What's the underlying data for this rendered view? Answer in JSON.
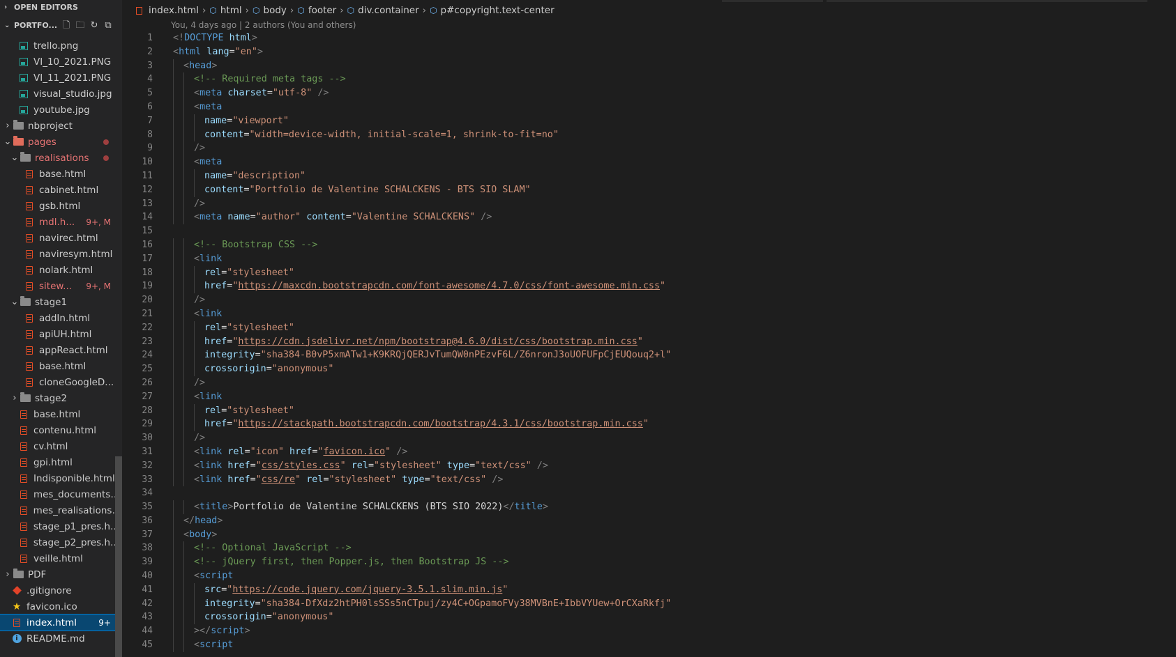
{
  "sidebar": {
    "open_editors_label": "OPEN EDITORS",
    "workspace_label": "PORTFO...",
    "items": [
      {
        "label": "trello.png",
        "icon": "image-file-icon",
        "indent": 2,
        "type": "img"
      },
      {
        "label": "VI_10_2021.PNG",
        "icon": "image-file-icon",
        "indent": 2,
        "type": "img"
      },
      {
        "label": "VI_11_2021.PNG",
        "icon": "image-file-icon",
        "indent": 2,
        "type": "img"
      },
      {
        "label": "visual_studio.jpg",
        "icon": "image-file-icon",
        "indent": 2,
        "type": "img"
      },
      {
        "label": "youtube.jpg",
        "icon": "image-file-icon",
        "indent": 2,
        "type": "img"
      },
      {
        "label": "nbproject",
        "icon": "folder-icon",
        "indent": 1,
        "type": "folder",
        "chevron": "›"
      },
      {
        "label": "pages",
        "icon": "folder-open-icon",
        "indent": 1,
        "type": "folder-red",
        "chevron": "⌄",
        "dot": true,
        "modified": true
      },
      {
        "label": "realisations",
        "icon": "folder-open-icon",
        "indent": 2,
        "type": "folder",
        "chevron": "⌄",
        "dot": true,
        "modified": true
      },
      {
        "label": "base.html",
        "icon": "html-file-icon",
        "indent": 3,
        "type": "html"
      },
      {
        "label": "cabinet.html",
        "icon": "html-file-icon",
        "indent": 3,
        "type": "html"
      },
      {
        "label": "gsb.html",
        "icon": "html-file-icon",
        "indent": 3,
        "type": "html"
      },
      {
        "label": "mdl.h...",
        "icon": "html-file-icon",
        "indent": 3,
        "type": "html",
        "badge": "9+, M",
        "modified": true
      },
      {
        "label": "navirec.html",
        "icon": "html-file-icon",
        "indent": 3,
        "type": "html"
      },
      {
        "label": "naviresym.html",
        "icon": "html-file-icon",
        "indent": 3,
        "type": "html"
      },
      {
        "label": "nolark.html",
        "icon": "html-file-icon",
        "indent": 3,
        "type": "html"
      },
      {
        "label": "sitew...",
        "icon": "html-file-icon",
        "indent": 3,
        "type": "html",
        "badge": "9+, M",
        "modified": true
      },
      {
        "label": "stage1",
        "icon": "folder-open-icon",
        "indent": 2,
        "type": "folder",
        "chevron": "⌄"
      },
      {
        "label": "addIn.html",
        "icon": "html-file-icon",
        "indent": 3,
        "type": "html"
      },
      {
        "label": "apiUH.html",
        "icon": "html-file-icon",
        "indent": 3,
        "type": "html"
      },
      {
        "label": "appReact.html",
        "icon": "html-file-icon",
        "indent": 3,
        "type": "html"
      },
      {
        "label": "base.html",
        "icon": "html-file-icon",
        "indent": 3,
        "type": "html"
      },
      {
        "label": "cloneGoogleD...",
        "icon": "html-file-icon",
        "indent": 3,
        "type": "html"
      },
      {
        "label": "stage2",
        "icon": "folder-icon",
        "indent": 2,
        "type": "folder",
        "chevron": "›"
      },
      {
        "label": "base.html",
        "icon": "html-file-icon",
        "indent": 2,
        "type": "html"
      },
      {
        "label": "contenu.html",
        "icon": "html-file-icon",
        "indent": 2,
        "type": "html"
      },
      {
        "label": "cv.html",
        "icon": "html-file-icon",
        "indent": 2,
        "type": "html"
      },
      {
        "label": "gpi.html",
        "icon": "html-file-icon",
        "indent": 2,
        "type": "html"
      },
      {
        "label": "Indisponible.html",
        "icon": "html-file-icon",
        "indent": 2,
        "type": "html"
      },
      {
        "label": "mes_documents....",
        "icon": "html-file-icon",
        "indent": 2,
        "type": "html"
      },
      {
        "label": "mes_realisations....",
        "icon": "html-file-icon",
        "indent": 2,
        "type": "html"
      },
      {
        "label": "stage_p1_pres.ht...",
        "icon": "html-file-icon",
        "indent": 2,
        "type": "html"
      },
      {
        "label": "stage_p2_pres.ht...",
        "icon": "html-file-icon",
        "indent": 2,
        "type": "html"
      },
      {
        "label": "veille.html",
        "icon": "html-file-icon",
        "indent": 2,
        "type": "html"
      },
      {
        "label": "PDF",
        "icon": "folder-icon",
        "indent": 1,
        "type": "folder",
        "chevron": "›"
      },
      {
        "label": ".gitignore",
        "icon": "git-icon",
        "indent": 1,
        "type": "git"
      },
      {
        "label": "favicon.ico",
        "icon": "star-icon",
        "indent": 1,
        "type": "star"
      },
      {
        "label": "index.html",
        "icon": "html-file-icon",
        "indent": 1,
        "type": "html",
        "badge": "9+",
        "selected": true
      },
      {
        "label": "README.md",
        "icon": "info-icon",
        "indent": 1,
        "type": "info"
      }
    ]
  },
  "breadcrumb": [
    {
      "label": "index.html",
      "icon": "html-file-icon"
    },
    {
      "label": "html",
      "icon": "element-icon"
    },
    {
      "label": "body",
      "icon": "element-icon"
    },
    {
      "label": "footer",
      "icon": "element-icon"
    },
    {
      "label": "div.container",
      "icon": "element-icon"
    },
    {
      "label": "p#copyright.text-center",
      "icon": "element-icon"
    }
  ],
  "blame": "You, 4 days ago | 2 authors (You and others)",
  "code_lines": [
    {
      "n": "1",
      "indent": 0,
      "tokens": [
        [
          "t",
          "<!"
        ],
        [
          "tag",
          "DOCTYPE"
        ],
        [
          "att",
          " html"
        ],
        [
          "t",
          ">"
        ]
      ]
    },
    {
      "n": "2",
      "indent": 0,
      "tokens": [
        [
          "t",
          "<"
        ],
        [
          "tag",
          "html"
        ],
        [
          "att",
          " lang"
        ],
        [
          "txt",
          "="
        ],
        [
          "str",
          "\"en\""
        ],
        [
          "t",
          ">"
        ]
      ]
    },
    {
      "n": "3",
      "indent": 1,
      "tokens": [
        [
          "t",
          "<"
        ],
        [
          "tag",
          "head"
        ],
        [
          "t",
          ">"
        ]
      ]
    },
    {
      "n": "4",
      "indent": 2,
      "tokens": [
        [
          "cm",
          "<!-- Required meta tags -->"
        ]
      ]
    },
    {
      "n": "5",
      "indent": 2,
      "tokens": [
        [
          "t",
          "<"
        ],
        [
          "tag",
          "meta"
        ],
        [
          "att",
          " charset"
        ],
        [
          "txt",
          "="
        ],
        [
          "str",
          "\"utf-8\""
        ],
        [
          "t",
          " />"
        ]
      ]
    },
    {
      "n": "6",
      "indent": 2,
      "tokens": [
        [
          "t",
          "<"
        ],
        [
          "tag",
          "meta"
        ]
      ]
    },
    {
      "n": "7",
      "indent": 3,
      "tokens": [
        [
          "att",
          "name"
        ],
        [
          "txt",
          "="
        ],
        [
          "str",
          "\"viewport\""
        ]
      ]
    },
    {
      "n": "8",
      "indent": 3,
      "tokens": [
        [
          "att",
          "content"
        ],
        [
          "txt",
          "="
        ],
        [
          "str",
          "\"width=device-width, initial-scale=1, shrink-to-fit=no\""
        ]
      ]
    },
    {
      "n": "9",
      "indent": 2,
      "tokens": [
        [
          "t",
          "/>"
        ]
      ]
    },
    {
      "n": "10",
      "indent": 2,
      "tokens": [
        [
          "t",
          "<"
        ],
        [
          "tag",
          "meta"
        ]
      ]
    },
    {
      "n": "11",
      "indent": 3,
      "tokens": [
        [
          "att",
          "name"
        ],
        [
          "txt",
          "="
        ],
        [
          "str",
          "\"description\""
        ]
      ]
    },
    {
      "n": "12",
      "indent": 3,
      "tokens": [
        [
          "att",
          "content"
        ],
        [
          "txt",
          "="
        ],
        [
          "str",
          "\"Portfolio de Valentine SCHALCKENS - BTS SIO SLAM\""
        ]
      ]
    },
    {
      "n": "13",
      "indent": 2,
      "tokens": [
        [
          "t",
          "/>"
        ]
      ]
    },
    {
      "n": "14",
      "indent": 2,
      "tokens": [
        [
          "t",
          "<"
        ],
        [
          "tag",
          "meta"
        ],
        [
          "att",
          " name"
        ],
        [
          "txt",
          "="
        ],
        [
          "str",
          "\"author\""
        ],
        [
          "att",
          " content"
        ],
        [
          "txt",
          "="
        ],
        [
          "str",
          "\"Valentine SCHALCKENS\""
        ],
        [
          "t",
          " />"
        ]
      ]
    },
    {
      "n": "15",
      "indent": 0,
      "tokens": []
    },
    {
      "n": "16",
      "indent": 2,
      "tokens": [
        [
          "cm",
          "<!-- Bootstrap CSS -->"
        ]
      ]
    },
    {
      "n": "17",
      "indent": 2,
      "tokens": [
        [
          "t",
          "<"
        ],
        [
          "tag",
          "link"
        ]
      ]
    },
    {
      "n": "18",
      "indent": 3,
      "tokens": [
        [
          "att",
          "rel"
        ],
        [
          "txt",
          "="
        ],
        [
          "str",
          "\"stylesheet\""
        ]
      ]
    },
    {
      "n": "19",
      "indent": 3,
      "tokens": [
        [
          "att",
          "href"
        ],
        [
          "txt",
          "="
        ],
        [
          "str",
          "\""
        ],
        [
          "url",
          "https://maxcdn.bootstrapcdn.com/font-awesome/4.7.0/css/font-awesome.min.css"
        ],
        [
          "str",
          "\""
        ]
      ]
    },
    {
      "n": "20",
      "indent": 2,
      "tokens": [
        [
          "t",
          "/>"
        ]
      ]
    },
    {
      "n": "21",
      "indent": 2,
      "tokens": [
        [
          "t",
          "<"
        ],
        [
          "tag",
          "link"
        ]
      ]
    },
    {
      "n": "22",
      "indent": 3,
      "tokens": [
        [
          "att",
          "rel"
        ],
        [
          "txt",
          "="
        ],
        [
          "str",
          "\"stylesheet\""
        ]
      ]
    },
    {
      "n": "23",
      "indent": 3,
      "tokens": [
        [
          "att",
          "href"
        ],
        [
          "txt",
          "="
        ],
        [
          "str",
          "\""
        ],
        [
          "url",
          "https://cdn.jsdelivr.net/npm/bootstrap@4.6.0/dist/css/bootstrap.min.css"
        ],
        [
          "str",
          "\""
        ]
      ]
    },
    {
      "n": "24",
      "indent": 3,
      "tokens": [
        [
          "att",
          "integrity"
        ],
        [
          "txt",
          "="
        ],
        [
          "str",
          "\"sha384-B0vP5xmATw1+K9KRQjQERJvTumQW0nPEzvF6L/Z6nronJ3oUOFUFpCjEUQouq2+l\""
        ]
      ]
    },
    {
      "n": "25",
      "indent": 3,
      "tokens": [
        [
          "att",
          "crossorigin"
        ],
        [
          "txt",
          "="
        ],
        [
          "str",
          "\"anonymous\""
        ]
      ]
    },
    {
      "n": "26",
      "indent": 2,
      "tokens": [
        [
          "t",
          "/>"
        ]
      ]
    },
    {
      "n": "27",
      "indent": 2,
      "tokens": [
        [
          "t",
          "<"
        ],
        [
          "tag",
          "link"
        ]
      ]
    },
    {
      "n": "28",
      "indent": 3,
      "tokens": [
        [
          "att",
          "rel"
        ],
        [
          "txt",
          "="
        ],
        [
          "str",
          "\"stylesheet\""
        ]
      ]
    },
    {
      "n": "29",
      "indent": 3,
      "tokens": [
        [
          "att",
          "href"
        ],
        [
          "txt",
          "="
        ],
        [
          "str",
          "\""
        ],
        [
          "url",
          "https://stackpath.bootstrapcdn.com/bootstrap/4.3.1/css/bootstrap.min.css"
        ],
        [
          "str",
          "\""
        ]
      ]
    },
    {
      "n": "30",
      "indent": 2,
      "tokens": [
        [
          "t",
          "/>"
        ]
      ]
    },
    {
      "n": "31",
      "indent": 2,
      "tokens": [
        [
          "t",
          "<"
        ],
        [
          "tag",
          "link"
        ],
        [
          "att",
          " rel"
        ],
        [
          "txt",
          "="
        ],
        [
          "str",
          "\"icon\""
        ],
        [
          "att",
          " href"
        ],
        [
          "txt",
          "="
        ],
        [
          "str",
          "\""
        ],
        [
          "url",
          "favicon.ico"
        ],
        [
          "str",
          "\""
        ],
        [
          "t",
          " />"
        ]
      ]
    },
    {
      "n": "32",
      "indent": 2,
      "tokens": [
        [
          "t",
          "<"
        ],
        [
          "tag",
          "link"
        ],
        [
          "att",
          " href"
        ],
        [
          "txt",
          "="
        ],
        [
          "str",
          "\""
        ],
        [
          "url",
          "css/styles.css"
        ],
        [
          "str",
          "\""
        ],
        [
          "att",
          " rel"
        ],
        [
          "txt",
          "="
        ],
        [
          "str",
          "\"stylesheet\""
        ],
        [
          "att",
          " type"
        ],
        [
          "txt",
          "="
        ],
        [
          "str",
          "\"text/css\""
        ],
        [
          "t",
          " />"
        ]
      ]
    },
    {
      "n": "33",
      "indent": 2,
      "tokens": [
        [
          "t",
          "<"
        ],
        [
          "tag",
          "link"
        ],
        [
          "att",
          " href"
        ],
        [
          "txt",
          "="
        ],
        [
          "str",
          "\""
        ],
        [
          "url",
          "css/re"
        ],
        [
          "str",
          "\""
        ],
        [
          "att",
          " rel"
        ],
        [
          "txt",
          "="
        ],
        [
          "str",
          "\"stylesheet\""
        ],
        [
          "att",
          " type"
        ],
        [
          "txt",
          "="
        ],
        [
          "str",
          "\"text/css\""
        ],
        [
          "t",
          " />"
        ]
      ]
    },
    {
      "n": "34",
      "indent": 0,
      "tokens": []
    },
    {
      "n": "35",
      "indent": 2,
      "tokens": [
        [
          "t",
          "<"
        ],
        [
          "tag",
          "title"
        ],
        [
          "t",
          ">"
        ],
        [
          "txt",
          "Portfolio de Valentine SCHALCKENS (BTS SIO 2022)"
        ],
        [
          "t",
          "</"
        ],
        [
          "tag",
          "title"
        ],
        [
          "t",
          ">"
        ]
      ]
    },
    {
      "n": "36",
      "indent": 1,
      "tokens": [
        [
          "t",
          "</"
        ],
        [
          "tag",
          "head"
        ],
        [
          "t",
          ">"
        ]
      ]
    },
    {
      "n": "37",
      "indent": 1,
      "tokens": [
        [
          "t",
          "<"
        ],
        [
          "tag",
          "body"
        ],
        [
          "t",
          ">"
        ]
      ]
    },
    {
      "n": "38",
      "indent": 2,
      "tokens": [
        [
          "cm",
          "<!-- Optional JavaScript -->"
        ]
      ]
    },
    {
      "n": "39",
      "indent": 2,
      "tokens": [
        [
          "cm",
          "<!-- jQuery first, then Popper.js, then Bootstrap JS -->"
        ]
      ]
    },
    {
      "n": "40",
      "indent": 2,
      "tokens": [
        [
          "t",
          "<"
        ],
        [
          "tag",
          "script"
        ]
      ]
    },
    {
      "n": "41",
      "indent": 3,
      "tokens": [
        [
          "att",
          "src"
        ],
        [
          "txt",
          "="
        ],
        [
          "str",
          "\""
        ],
        [
          "url",
          "https://code.jquery.com/jquery-3.5.1.slim.min.js"
        ],
        [
          "str",
          "\""
        ]
      ]
    },
    {
      "n": "42",
      "indent": 3,
      "tokens": [
        [
          "att",
          "integrity"
        ],
        [
          "txt",
          "="
        ],
        [
          "str",
          "\"sha384-DfXdz2htPH0lsSSs5nCTpuj/zy4C+OGpamoFVy38MVBnE+IbbVYUew+OrCXaRkfj\""
        ]
      ]
    },
    {
      "n": "43",
      "indent": 3,
      "tokens": [
        [
          "att",
          "crossorigin"
        ],
        [
          "txt",
          "="
        ],
        [
          "str",
          "\"anonymous\""
        ]
      ]
    },
    {
      "n": "44",
      "indent": 2,
      "tokens": [
        [
          "t",
          "></"
        ],
        [
          "tag",
          "script"
        ],
        [
          "t",
          ">"
        ]
      ]
    },
    {
      "n": "45",
      "indent": 2,
      "tokens": [
        [
          "t",
          "<"
        ],
        [
          "tag",
          "script"
        ]
      ]
    }
  ]
}
